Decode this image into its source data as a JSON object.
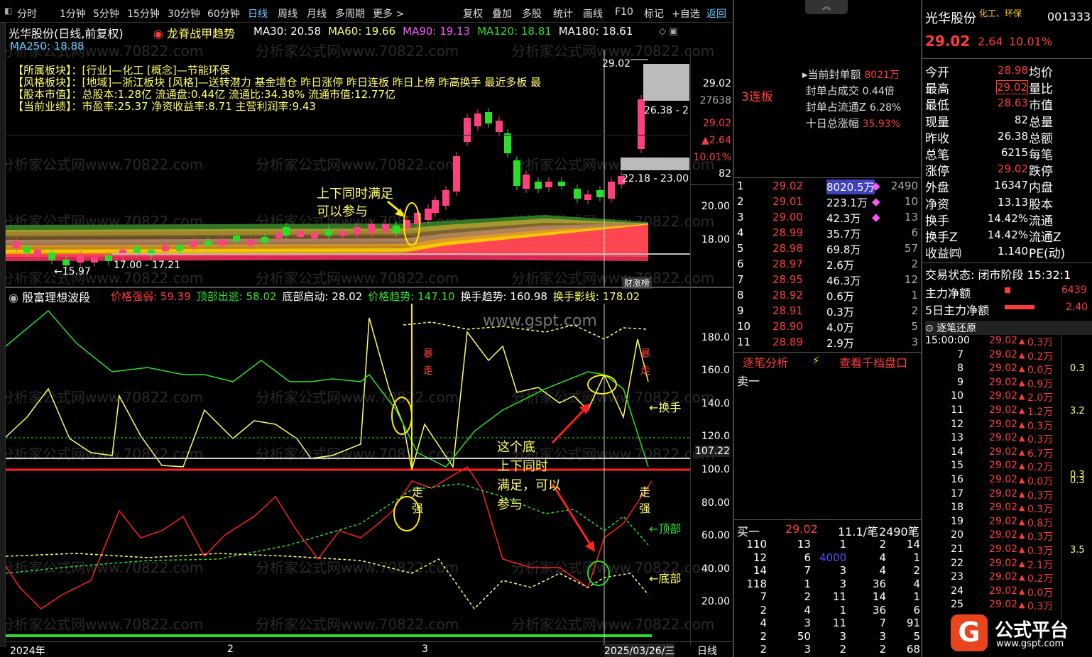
{
  "toolbar": {
    "periods": [
      "分时",
      "1分钟",
      "5分钟",
      "15分钟",
      "30分钟",
      "60分钟",
      "日线",
      "周线",
      "月线",
      "多周期",
      "更多 >"
    ],
    "tools": [
      "复权",
      "叠加",
      "多股",
      "统计",
      "画线",
      "F10",
      "标记",
      "+自选",
      "返回"
    ]
  },
  "main": {
    "stock_title": "光华股份(日线,前复权)",
    "indicator": "龙脊战甲趋势",
    "ma": [
      {
        "label": "MA30: 20.58",
        "color": "#ffffff"
      },
      {
        "label": "MA60: 19.66",
        "color": "#ffff66"
      },
      {
        "label": "MA90: 19.13",
        "color": "#ff55ff"
      },
      {
        "label": "MA120: 18.81",
        "color": "#29e029"
      },
      {
        "label": "MA180: 18.61",
        "color": "#ffffff"
      }
    ],
    "ma250": "MA250: 18.88",
    "info": [
      {
        "k": "所属板块",
        "v": "[行业]—化工 [概念]—节能环保"
      },
      {
        "k": "风格板块",
        "v": "[地域]—浙江板块 [风格]—送转潜力 基金增仓 昨日涨停 昨日连板 昨日上榜 昨高换手 最近多板 最"
      },
      {
        "k": "股本市值",
        "v": "总股本:1.28亿 流通盘:0.44亿 流通比:34.38% 流通市值:12.77亿"
      },
      {
        "k": "当前业绩",
        "v": "市盈率:25.37 净资收益率:8.71 主营利润率:9.43"
      }
    ],
    "price_high_label": "29.02",
    "price_low_label": "15.97",
    "range1": "17.00 - 17.21",
    "range2": "22.18 - 23.00",
    "range3": "26.38 - 2",
    "annot1_line1": "上下同时满足",
    "annot1_line2": "可以参与",
    "badge": "财涨榜",
    "axis": [
      "29.02",
      "27638",
      "29.02",
      "2.64",
      "10.01%",
      "82",
      "20.00",
      "18.00"
    ]
  },
  "osc": {
    "title": "殷富理想波段",
    "items": [
      {
        "label": "价格强弱: 59.39",
        "color": "#ff3c3c"
      },
      {
        "label": "顶部出逃: 58.02",
        "color": "#29e029"
      },
      {
        "label": "底部启动: 28.02",
        "color": "#ffffff"
      },
      {
        "label": "价格趋势: 147.10",
        "color": "#29e029"
      },
      {
        "label": "换手趋势: 160.98",
        "color": "#ffffff"
      },
      {
        "label": "换手影线: 178.02",
        "color": "#ffff66"
      }
    ],
    "axis": [
      "180.0",
      "160.0",
      "140.0",
      "120.0",
      "107.22",
      "100.0",
      "80.00",
      "60.00",
      "40.00",
      "20.00"
    ],
    "tags": {
      "huanshou": "换手",
      "dingbu": "顶部",
      "dibu": "底部",
      "bao": "暴",
      "zou": "走",
      "qiang": "强",
      "zou2": "走"
    },
    "annot2": [
      "这个底",
      "上下同时",
      "满足，可以",
      "参与"
    ],
    "xaxis": [
      "2024年",
      "2",
      "3",
      "2025/03/26/三"
    ],
    "period": "日线",
    "gspt": "www.gspt.com"
  },
  "order": {
    "limit_label": "3连板",
    "stats": [
      {
        "k": "当前封单额",
        "v": "8021万"
      },
      {
        "k": "封单占成交",
        "v": "0.44倍"
      },
      {
        "k": "封单占流通Z",
        "v": "6.28%"
      },
      {
        "k": "十日总涨幅",
        "v": "35.93%"
      }
    ],
    "sells_title": "卖一",
    "bids": [
      {
        "n": "1",
        "p": "29.02",
        "v": "8020.5万",
        "c": "2490"
      },
      {
        "n": "2",
        "p": "29.01",
        "v": "223.1万",
        "c": "10"
      },
      {
        "n": "3",
        "p": "29.00",
        "v": "42.3万",
        "c": "13"
      },
      {
        "n": "4",
        "p": "28.99",
        "v": "35.7万",
        "c": "6"
      },
      {
        "n": "5",
        "p": "28.98",
        "v": "69.8万",
        "c": "57"
      },
      {
        "n": "6",
        "p": "28.97",
        "v": "2.6万",
        "c": "2"
      },
      {
        "n": "7",
        "p": "28.95",
        "v": "46.3万",
        "c": "12"
      },
      {
        "n": "8",
        "p": "28.92",
        "v": "0.6万",
        "c": "1"
      },
      {
        "n": "9",
        "p": "28.91",
        "v": "0.3万",
        "c": "2"
      },
      {
        "n": "10",
        "p": "28.90",
        "v": "4.0万",
        "c": "5"
      },
      {
        "n": "11",
        "p": "28.89",
        "v": "2.9万",
        "c": "3"
      }
    ],
    "tabs": [
      "逐笔分析",
      "查看千档盘口"
    ],
    "buy1": {
      "label": "买一",
      "p": "29.02",
      "v": "11.1/笔",
      "c": "2490笔"
    },
    "queue": [
      [
        "110",
        "13",
        "1",
        "2",
        "14"
      ],
      [
        "12",
        "6",
        "4000",
        "4",
        "1"
      ],
      [
        "14",
        "7",
        "3",
        "4",
        "2"
      ],
      [
        "118",
        "1",
        "3",
        "36",
        "4"
      ],
      [
        "7",
        "2",
        "11",
        "14",
        "1"
      ],
      [
        "2",
        "4",
        "1",
        "36",
        "6"
      ],
      [
        "4",
        "3",
        "11",
        "7",
        "91"
      ],
      [
        "2",
        "50",
        "3",
        "3",
        "5"
      ],
      [
        "2",
        "3",
        "2",
        "2",
        "68"
      ]
    ]
  },
  "quote": {
    "name": "光华股份",
    "sector": "化工、环保",
    "code": "001333",
    "price": "29.02",
    "chg": "2.64",
    "pct": "10.01%",
    "rows": [
      {
        "k": "今开",
        "v": "28.98",
        "k2": "均价"
      },
      {
        "k": "最高",
        "v": "29.02",
        "k2": "量比"
      },
      {
        "k": "最低",
        "v": "28.63",
        "k2": "市值"
      },
      {
        "k": "现量",
        "v": "82",
        "k2": "总量"
      },
      {
        "k": "昨收",
        "v": "26.38",
        "k2": "总额"
      },
      {
        "k": "总笔",
        "v": "6215",
        "k2": "每笔"
      },
      {
        "k": "涨停",
        "v": "29.02",
        "k2": "跌停"
      },
      {
        "k": "外盘",
        "v": "16347",
        "k2": "内盘"
      },
      {
        "k": "净资",
        "v": "13.13",
        "k2": "股本"
      },
      {
        "k": "换手",
        "v": "14.42%",
        "k2": "流通"
      },
      {
        "k": "换手Z",
        "v": "14.42%",
        "k2": "流通Z"
      },
      {
        "k": "收益㈣",
        "v": "1.140",
        "k2": "PE(动)"
      }
    ],
    "trade_state": "交易状态: 闭市阶段 15:32:1",
    "main_flow": "主力净额",
    "main_flow_v": "6439",
    "main5": "5日主力净额",
    "main5_v": "2.40",
    "ticks_title": "逐笔还原",
    "ticks": [
      {
        "t": "15:00:00",
        "p": "29.02",
        "v": "0.3万"
      },
      {
        "t": "7",
        "p": "29.02",
        "v": "0.2万"
      },
      {
        "t": "8",
        "p": "29.02",
        "v": "0.0万"
      },
      {
        "t": "9",
        "p": "29.02",
        "v": "0.9万"
      },
      {
        "t": "10",
        "p": "29.02",
        "v": "2.0万"
      },
      {
        "t": "11",
        "p": "29.02",
        "v": "1.2万"
      },
      {
        "t": "12",
        "p": "29.02",
        "v": "0.3万"
      },
      {
        "t": "13",
        "p": "29.02",
        "v": "0.3万"
      },
      {
        "t": "14",
        "p": "29.02",
        "v": "6.7万"
      },
      {
        "t": "15",
        "p": "29.02",
        "v": "0.2万"
      },
      {
        "t": "16",
        "p": "29.02",
        "v": "0.0万"
      },
      {
        "t": "17",
        "p": "29.02",
        "v": "0.3万"
      },
      {
        "t": "18",
        "p": "29.02",
        "v": "0.3万"
      },
      {
        "t": "19",
        "p": "29.02",
        "v": "0.8万"
      },
      {
        "t": "20",
        "p": "29.02",
        "v": "0.3万"
      },
      {
        "t": "21",
        "p": "29.02",
        "v": "0.3万"
      },
      {
        "t": "22",
        "p": "29.02",
        "v": "2.1万"
      },
      {
        "t": "23",
        "p": "29.02",
        "v": "0.2万"
      },
      {
        "t": "24",
        "p": "29.02",
        "v": "0.0万"
      },
      {
        "t": "25",
        "p": "29.02",
        "v": "0.3万"
      }
    ],
    "side_vals": [
      "0.3",
      "3.2",
      "0.3",
      "3.5",
      "0.3"
    ]
  },
  "brand": {
    "logo_text": "公式平台",
    "url": "www.gspt.com"
  },
  "watermark": "分析家公式网www.70822.com"
}
